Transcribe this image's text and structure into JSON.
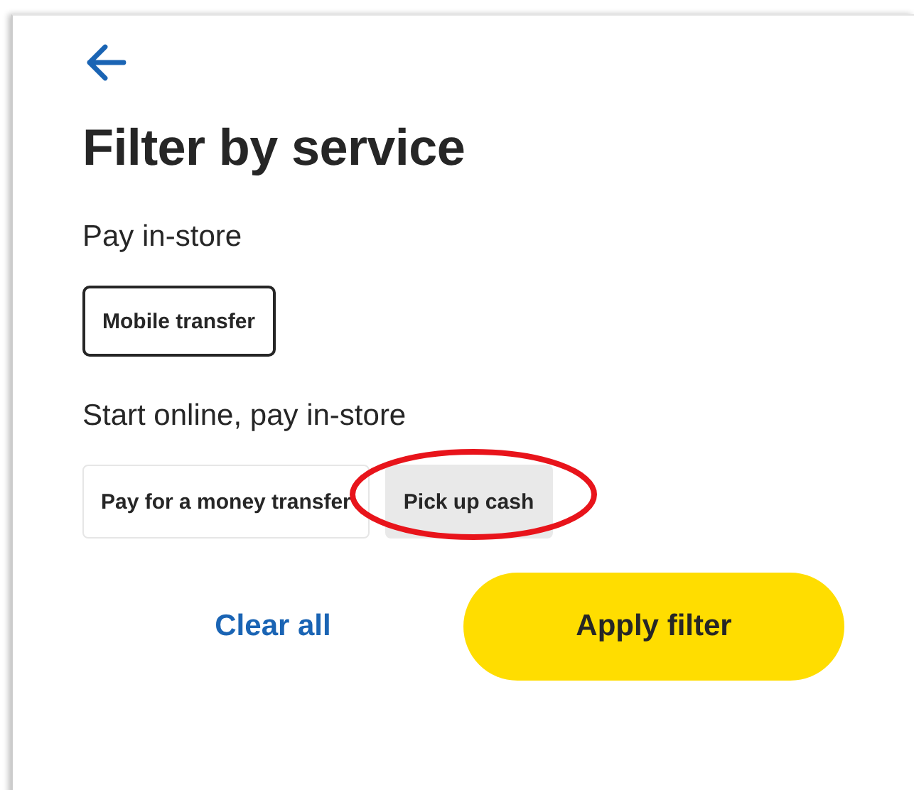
{
  "title": "Filter by service",
  "sections": [
    {
      "heading": "Pay in-store",
      "chips": [
        {
          "label": "Mobile transfer",
          "selected": true,
          "hovered": false,
          "circled": false
        }
      ]
    },
    {
      "heading": "Start online, pay in-store",
      "chips": [
        {
          "label": "Pay for a money transfer",
          "selected": false,
          "hovered": false,
          "circled": false
        },
        {
          "label": "Pick up cash",
          "selected": false,
          "hovered": true,
          "circled": true
        }
      ]
    }
  ],
  "actions": {
    "clear": "Clear all",
    "apply": "Apply filter"
  }
}
